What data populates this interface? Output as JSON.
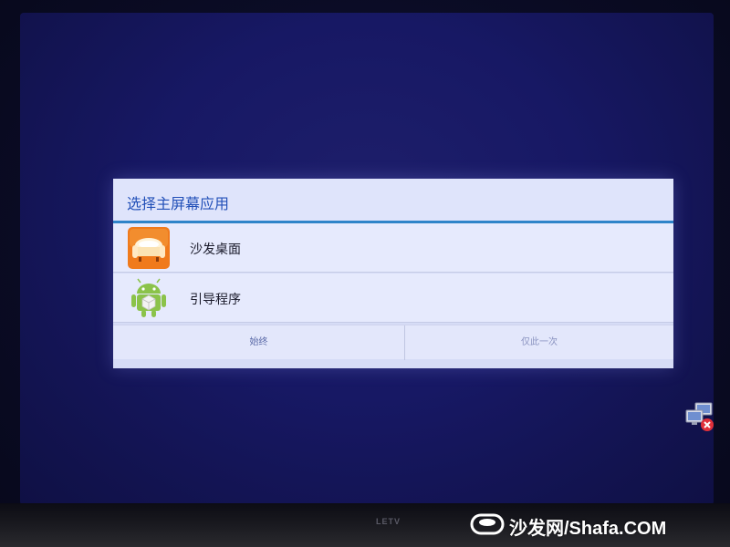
{
  "dialog": {
    "title": "选择主屏幕应用",
    "apps": [
      {
        "label": "沙发桌面",
        "icon": "sofa-app-icon"
      },
      {
        "label": "引导程序",
        "icon": "android-icon"
      }
    ],
    "buttons": {
      "always": "始终",
      "just_once": "仅此一次"
    }
  },
  "tv": {
    "brand": "LETV"
  },
  "status": {
    "network_icon": "network-disconnected-icon"
  },
  "watermark": {
    "text": "沙发网/Shafa.COM",
    "logo": "sofa-logo-icon"
  },
  "colors": {
    "title_text": "#2250b8",
    "divider": "#2f84c9",
    "dialog_bg": "#d6dcf6",
    "sofa_icon": "#f07a1c",
    "android_green": "#8bc34a"
  }
}
